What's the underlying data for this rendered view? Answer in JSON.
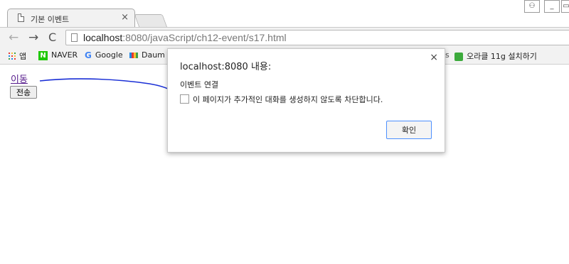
{
  "browser": {
    "tab": {
      "title": "기본 이벤트",
      "close": "×"
    },
    "window_buttons": {
      "user": "⚇",
      "minimize": "▭"
    },
    "nav": {
      "back": "←",
      "forward": "→",
      "reload": "C"
    },
    "url": {
      "host": "localhost",
      "rest": ":8080/javaScript/ch12-event/s17.html"
    }
  },
  "bookmarks": {
    "items": [
      {
        "label": "앱",
        "icon": "apps-grid-icon"
      },
      {
        "label": "NAVER",
        "icon": "naver-icon"
      },
      {
        "label": "Google",
        "icon": "google-icon"
      },
      {
        "label": "Daum",
        "icon": "daum-icon"
      }
    ],
    "right_item": {
      "label": "오라클 11g 설치하기",
      "icon": "oracle-icon"
    },
    "right_fragment": "s"
  },
  "page": {
    "link_text": "이동",
    "button_label": "전송"
  },
  "dialog": {
    "title": "localhost:8080 내용:",
    "close": "×",
    "message": "이벤트 연결",
    "checkbox_label": "이 페이지가 추가적인 대화를 생성하지 않도록 차단합니다.",
    "ok_label": "확인"
  },
  "colors": {
    "link": "#551a8b",
    "annotation": "#1a2fd6",
    "focus": "#4d90fe"
  }
}
